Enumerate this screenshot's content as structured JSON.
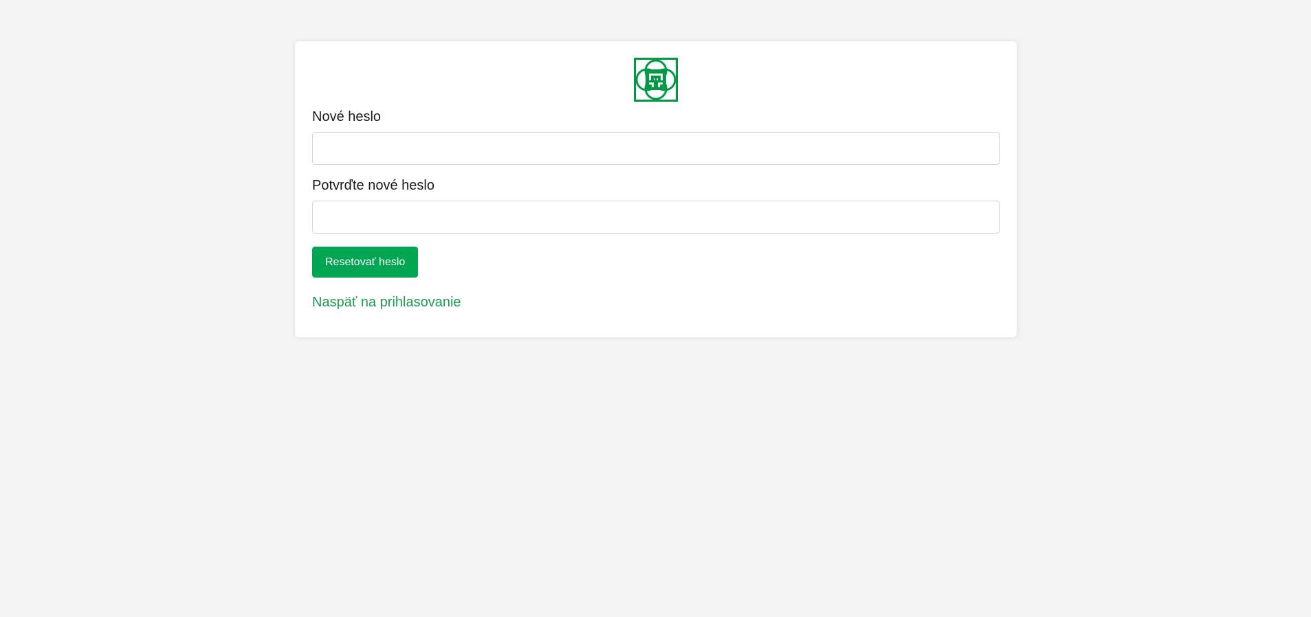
{
  "logo": {
    "icon": "company-logo-icon",
    "color": "#009a44"
  },
  "form": {
    "new_password_label": "Nové heslo",
    "new_password_value": "",
    "confirm_password_label": "Potvrďte nové heslo",
    "confirm_password_value": "",
    "submit_label": "Resetovať heslo",
    "back_link_label": "Naspäť na prihlasovanie"
  },
  "colors": {
    "accent": "#00a651",
    "link": "#1e9a52",
    "background": "#f3f3f3",
    "card": "#ffffff"
  }
}
